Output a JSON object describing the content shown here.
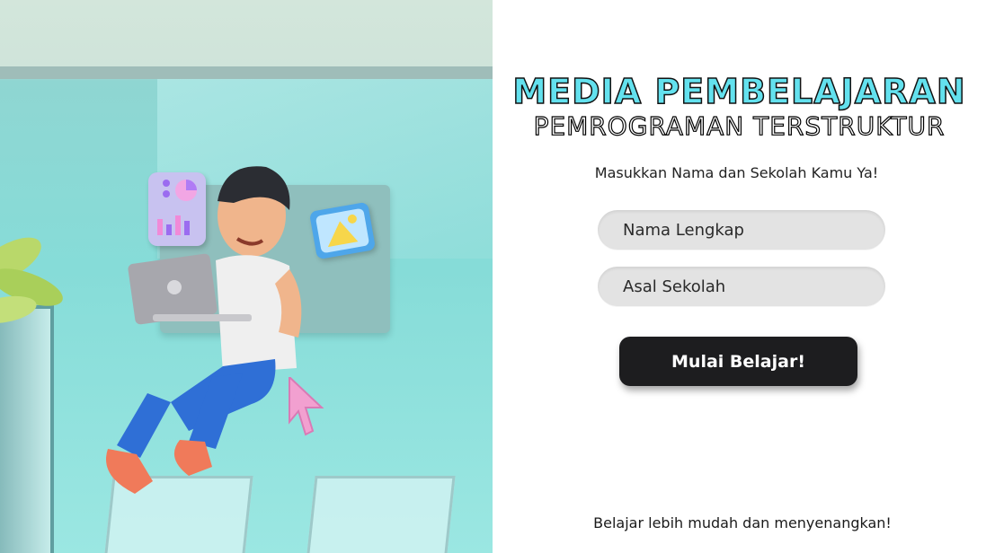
{
  "header": {
    "title": "MEDIA PEMBELAJARAN",
    "subtitle": "PEMROGRAMAN TERSTRUKTUR"
  },
  "form": {
    "prompt": "Masukkan Nama dan Sekolah Kamu Ya!",
    "name_placeholder": "Nama Lengkap",
    "school_placeholder": "Asal Sekolah",
    "submit_label": "Mulai Belajar!"
  },
  "footer": {
    "tagline": "Belajar lebih mudah dan menyenangkan!"
  },
  "colors": {
    "title_accent": "#63e1ee",
    "button_bg": "#1d1d1f",
    "panel_bg": "#ffffff",
    "illustration_bg": "#86dcd8"
  },
  "icons": [
    "chart-card-icon",
    "image-card-icon",
    "cursor-arrow-icon",
    "laptop-icon"
  ]
}
